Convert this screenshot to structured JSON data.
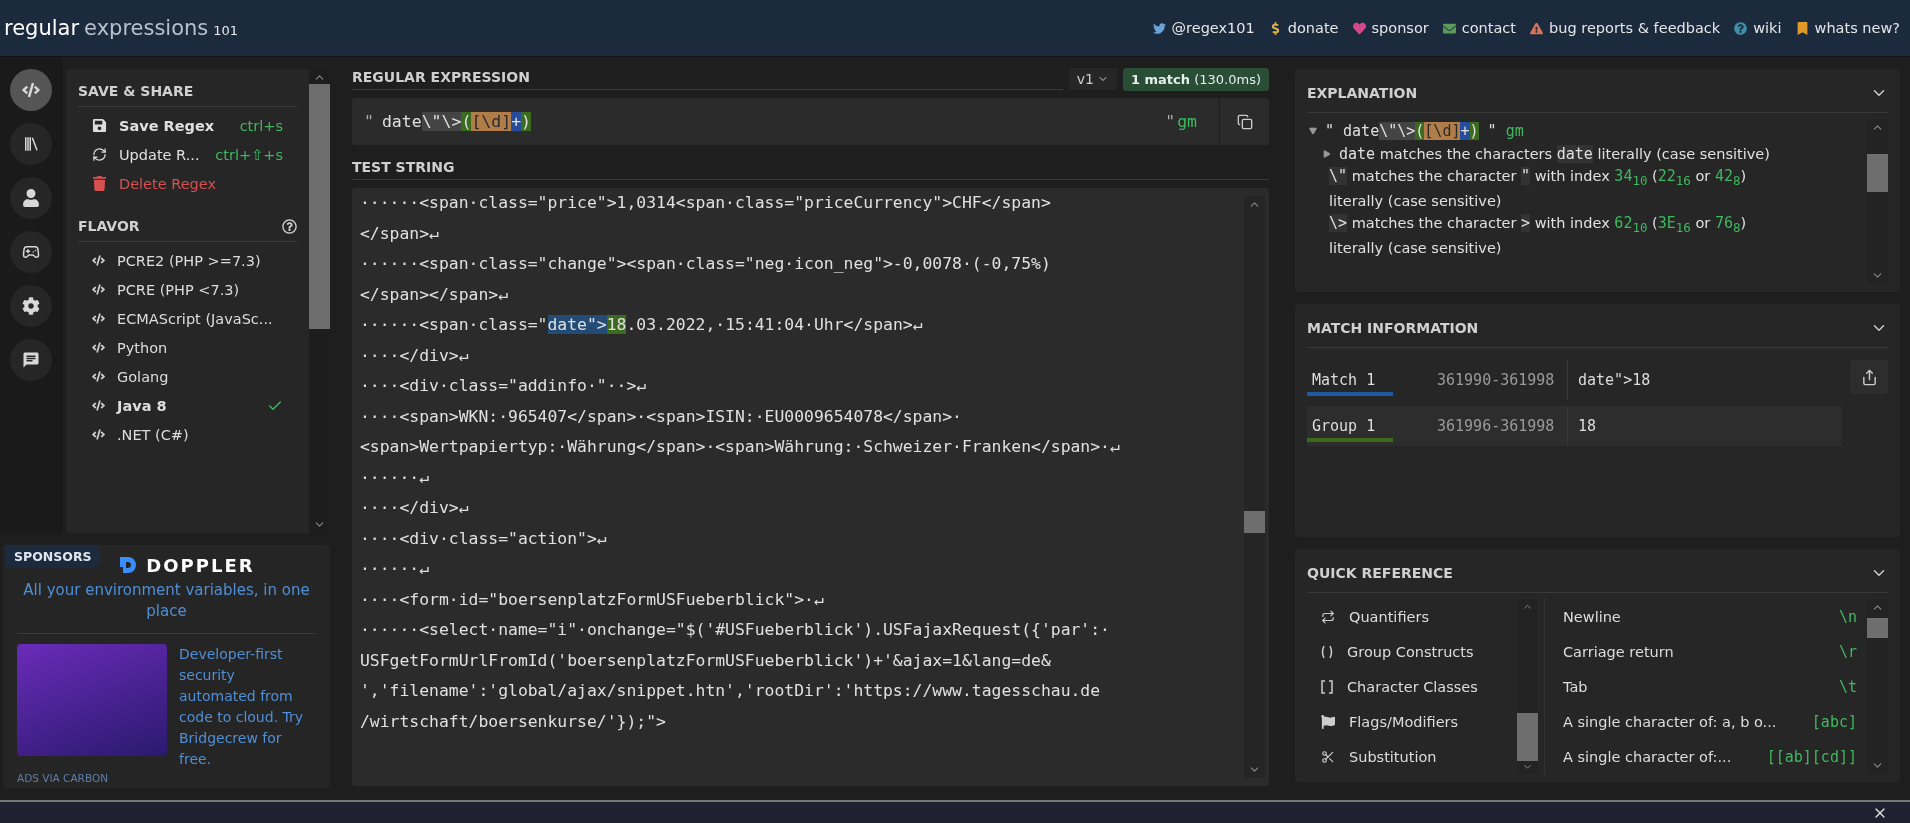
{
  "header": {
    "logo": {
      "main": "regular",
      "rest": "expressions",
      "version": "101"
    },
    "links": [
      {
        "label": "@regex101"
      },
      {
        "label": "donate"
      },
      {
        "label": "sponsor"
      },
      {
        "label": "contact"
      },
      {
        "label": "bug reports & feedback"
      },
      {
        "label": "wiki"
      },
      {
        "label": "whats new?"
      }
    ]
  },
  "nav": [
    {
      "selected": true
    },
    {
      "selected": false
    },
    {
      "selected": false
    },
    {
      "selected": false
    },
    {
      "selected": false
    },
    {
      "selected": false
    }
  ],
  "save_share": {
    "title": "SAVE & SHARE",
    "items": [
      {
        "kind": "save",
        "label": "Save Regex",
        "shortcut": "ctrl+s"
      },
      {
        "kind": "update",
        "label": "Update R...",
        "shortcut": "ctrl+⇧+s"
      },
      {
        "kind": "delete",
        "label": "Delete Regex"
      }
    ]
  },
  "flavor": {
    "title": "FLAVOR",
    "items": [
      {
        "label": "PCRE2 (PHP >=7.3)",
        "selected": false
      },
      {
        "label": "PCRE (PHP <7.3)",
        "selected": false
      },
      {
        "label": "ECMAScript (JavaSc...",
        "selected": false
      },
      {
        "label": "Python",
        "selected": false
      },
      {
        "label": "Golang",
        "selected": false
      },
      {
        "label": "Java 8",
        "selected": true
      },
      {
        "label": ".NET (C#)",
        "selected": false
      }
    ]
  },
  "sponsors": {
    "badge": "SPONSORS",
    "brand": "DOPPLER",
    "tagline": "All your environment variables, in one place",
    "ad_text": "Developer-first security automated from code to cloud. Try Bridgecrew for free.",
    "ad_credit": "ADS VIA CARBON"
  },
  "regex": {
    "title": "REGULAR EXPRESSION",
    "version": "v1",
    "match_count": "1 match",
    "time": "(130.0ms)",
    "delimiter": "\"",
    "closing_delimiter": "\"",
    "flags": "gm",
    "segments": [
      {
        "kind": "plain",
        "text": "date"
      },
      {
        "kind": "escape",
        "text": "\\\"\\>"
      },
      {
        "kind": "group",
        "text": "("
      },
      {
        "kind": "class",
        "text": "[\\d]"
      },
      {
        "kind": "quantifier",
        "text": "+"
      },
      {
        "kind": "group",
        "text": ")"
      }
    ]
  },
  "test_string": {
    "title": "TEST STRING",
    "lines": [
      [
        {
          "kind": "plain",
          "text": "······<span·class=\"price\">1,0314<span·class=\"priceCurrency\">CHF</span>"
        }
      ],
      [
        {
          "kind": "plain",
          "text": "</span>↵"
        }
      ],
      [
        {
          "kind": "plain",
          "text": "······<span·class=\"change\"><span·class=\"neg·icon_neg\">-0,0078·(-0,75%)"
        }
      ],
      [
        {
          "kind": "plain",
          "text": "</span></span>↵"
        }
      ],
      [
        {
          "kind": "plain",
          "text": "······<span·class=\""
        },
        {
          "kind": "match",
          "text": "date\">"
        },
        {
          "kind": "group",
          "text": "18"
        },
        {
          "kind": "plain",
          "text": ".03.2022,·15:41:04·Uhr</span>↵"
        }
      ],
      [
        {
          "kind": "plain",
          "text": "····</div>↵"
        }
      ],
      [
        {
          "kind": "plain",
          "text": "····<div·class=\"addinfo·\"··>↵"
        }
      ],
      [
        {
          "kind": "plain",
          "text": "····<span>WKN:·965407</span>·<span>ISIN:·EU0009654078</span>·"
        }
      ],
      [
        {
          "kind": "plain",
          "text": "<span>Wertpapiertyp:·Währung</span>·<span>Währung:·Schweizer·Franken</span>·↵"
        }
      ],
      [
        {
          "kind": "plain",
          "text": "······↵"
        }
      ],
      [
        {
          "kind": "plain",
          "text": "····</div>↵"
        }
      ],
      [
        {
          "kind": "plain",
          "text": "····<div·class=\"action\">↵"
        }
      ],
      [
        {
          "kind": "plain",
          "text": "······↵"
        }
      ],
      [
        {
          "kind": "plain",
          "text": "····<form·id=\"boersenplatzFormUSFueberblick\">·↵"
        }
      ],
      [
        {
          "kind": "plain",
          "text": "······<select·name=\"i\"·onchange=\"$('#USFueberblick').USFajaxRequest({'par':·"
        }
      ],
      [
        {
          "kind": "plain",
          "text": "USFgetFormUrlFromId('boersenplatzFormUSFueberblick')+'&ajax=1&lang=de&"
        }
      ],
      [
        {
          "kind": "plain",
          "text": "','filename':'global/ajax/snippet.htn','rootDir':'https://www.tagesschau.de"
        }
      ],
      [
        {
          "kind": "plain",
          "text": "/wirtschaft/boersenkurse/'});\">"
        }
      ]
    ]
  },
  "explanation": {
    "title": "EXPLANATION",
    "lines": [
      {
        "expanded": true,
        "segments": [
          {
            "kind": "plain",
            "text": "\" date"
          },
          {
            "kind": "escape",
            "text": "\\\"\\>"
          },
          {
            "kind": "group",
            "text": "("
          },
          {
            "kind": "class",
            "text": "[\\d]"
          },
          {
            "kind": "quantifier",
            "text": "+"
          },
          {
            "kind": "group",
            "text": ")"
          },
          {
            "kind": "plain",
            "text": " \" "
          },
          {
            "kind": "flags",
            "text": "gm"
          }
        ]
      },
      {
        "expanded": false,
        "segments": [
          {
            "kind": "mono",
            "text": "date"
          },
          {
            "kind": "text",
            "text": " matches the characters "
          },
          {
            "kind": "code",
            "text": "date"
          },
          {
            "kind": "text",
            "text": " literally (case sensitive)"
          }
        ]
      },
      {
        "segments": [
          {
            "kind": "code",
            "text": "\\\""
          },
          {
            "kind": "text",
            "text": " matches the character "
          },
          {
            "kind": "code",
            "text": "\""
          },
          {
            "kind": "text",
            "text": " with index "
          },
          {
            "kind": "num",
            "text": "34$_{10}$"
          },
          {
            "kind": "text",
            "text": " ("
          },
          {
            "kind": "num",
            "text": "22$_{16}$"
          },
          {
            "kind": "text",
            "text": " or "
          },
          {
            "kind": "num",
            "text": "42$_{8}$"
          },
          {
            "kind": "text",
            "text": ")"
          }
        ]
      },
      {
        "segments": [
          {
            "kind": "text",
            "text": "literally (case sensitive)"
          }
        ]
      },
      {
        "segments": [
          {
            "kind": "code",
            "text": "\\>"
          },
          {
            "kind": "text",
            "text": " matches the character "
          },
          {
            "kind": "code",
            "text": ">"
          },
          {
            "kind": "text",
            "text": " with index "
          },
          {
            "kind": "num",
            "text": "62$_{10}$"
          },
          {
            "kind": "text",
            "text": " ("
          },
          {
            "kind": "num",
            "text": "3E$_{16}$"
          },
          {
            "kind": "text",
            "text": " or "
          },
          {
            "kind": "num",
            "text": "76$_{8}$"
          },
          {
            "kind": "text",
            "text": ")"
          }
        ]
      },
      {
        "segments": [
          {
            "kind": "text",
            "text": "literally (case sensitive)"
          }
        ]
      }
    ]
  },
  "match_information": {
    "title": "MATCH INFORMATION",
    "rows": [
      {
        "kind": "match",
        "label": "Match 1",
        "range": "361990-361998",
        "value": "date\">18"
      },
      {
        "kind": "group",
        "label": "Group 1",
        "range": "361996-361998",
        "value": "18"
      }
    ]
  },
  "quick_reference": {
    "title": "QUICK REFERENCE",
    "categories": [
      {
        "label": "Quantifiers"
      },
      {
        "label": "Group Constructs"
      },
      {
        "label": "Character Classes"
      },
      {
        "label": "Flags/Modifiers"
      },
      {
        "label": "Substitution"
      }
    ],
    "tokens": [
      {
        "description": "Newline",
        "token": "\\n"
      },
      {
        "description": "Carriage return",
        "token": "\\r"
      },
      {
        "description": "Tab",
        "token": "\\t"
      },
      {
        "description": "A single character of: a, b o...",
        "token": "[abc]"
      },
      {
        "description": "A single character of:...",
        "token": "[[ab][cd]]"
      }
    ]
  }
}
